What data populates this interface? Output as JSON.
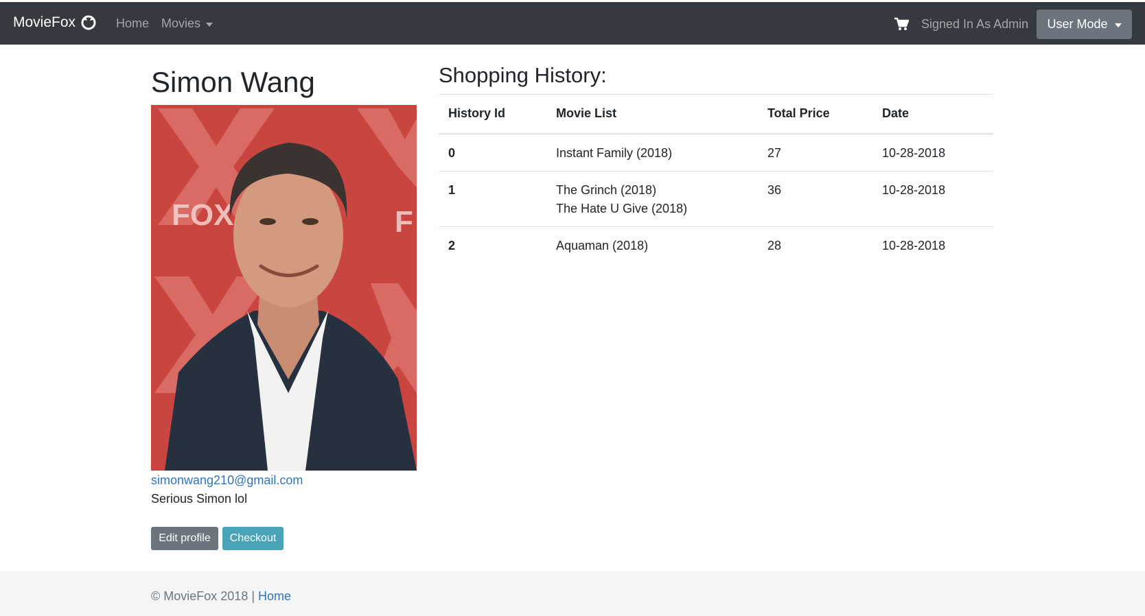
{
  "navbar": {
    "brand": "MovieFox",
    "brand_icon": "fox-logo-icon",
    "home_label": "Home",
    "movies_label": "Movies",
    "cart_icon": "cart-icon",
    "signed_in_text": "Signed In As Admin",
    "user_mode_label": "User Mode",
    "bg_color": "#343a40"
  },
  "profile": {
    "name": "Simon Wang",
    "email": "simonwang210@gmail.com",
    "bio": "Serious Simon lol",
    "edit_label": "Edit profile",
    "checkout_label": "Checkout"
  },
  "history": {
    "title": "Shopping History:",
    "columns": [
      "History Id",
      "Movie List",
      "Total Price",
      "Date"
    ],
    "rows": [
      {
        "id": "0",
        "movies": [
          "Instant Family (2018)"
        ],
        "price": "27",
        "date": "10-28-2018"
      },
      {
        "id": "1",
        "movies": [
          "The Grinch (2018)",
          "The Hate U Give (2018)"
        ],
        "price": "36",
        "date": "10-28-2018"
      },
      {
        "id": "2",
        "movies": [
          "Aquaman (2018)"
        ],
        "price": "28",
        "date": "10-28-2018"
      }
    ]
  },
  "footer": {
    "copyright": "© MovieFox 2018 | ",
    "home_link": "Home"
  },
  "colors": {
    "link": "#3276b6",
    "checkout": "#4ba3b8",
    "secondary": "#6c757d"
  }
}
